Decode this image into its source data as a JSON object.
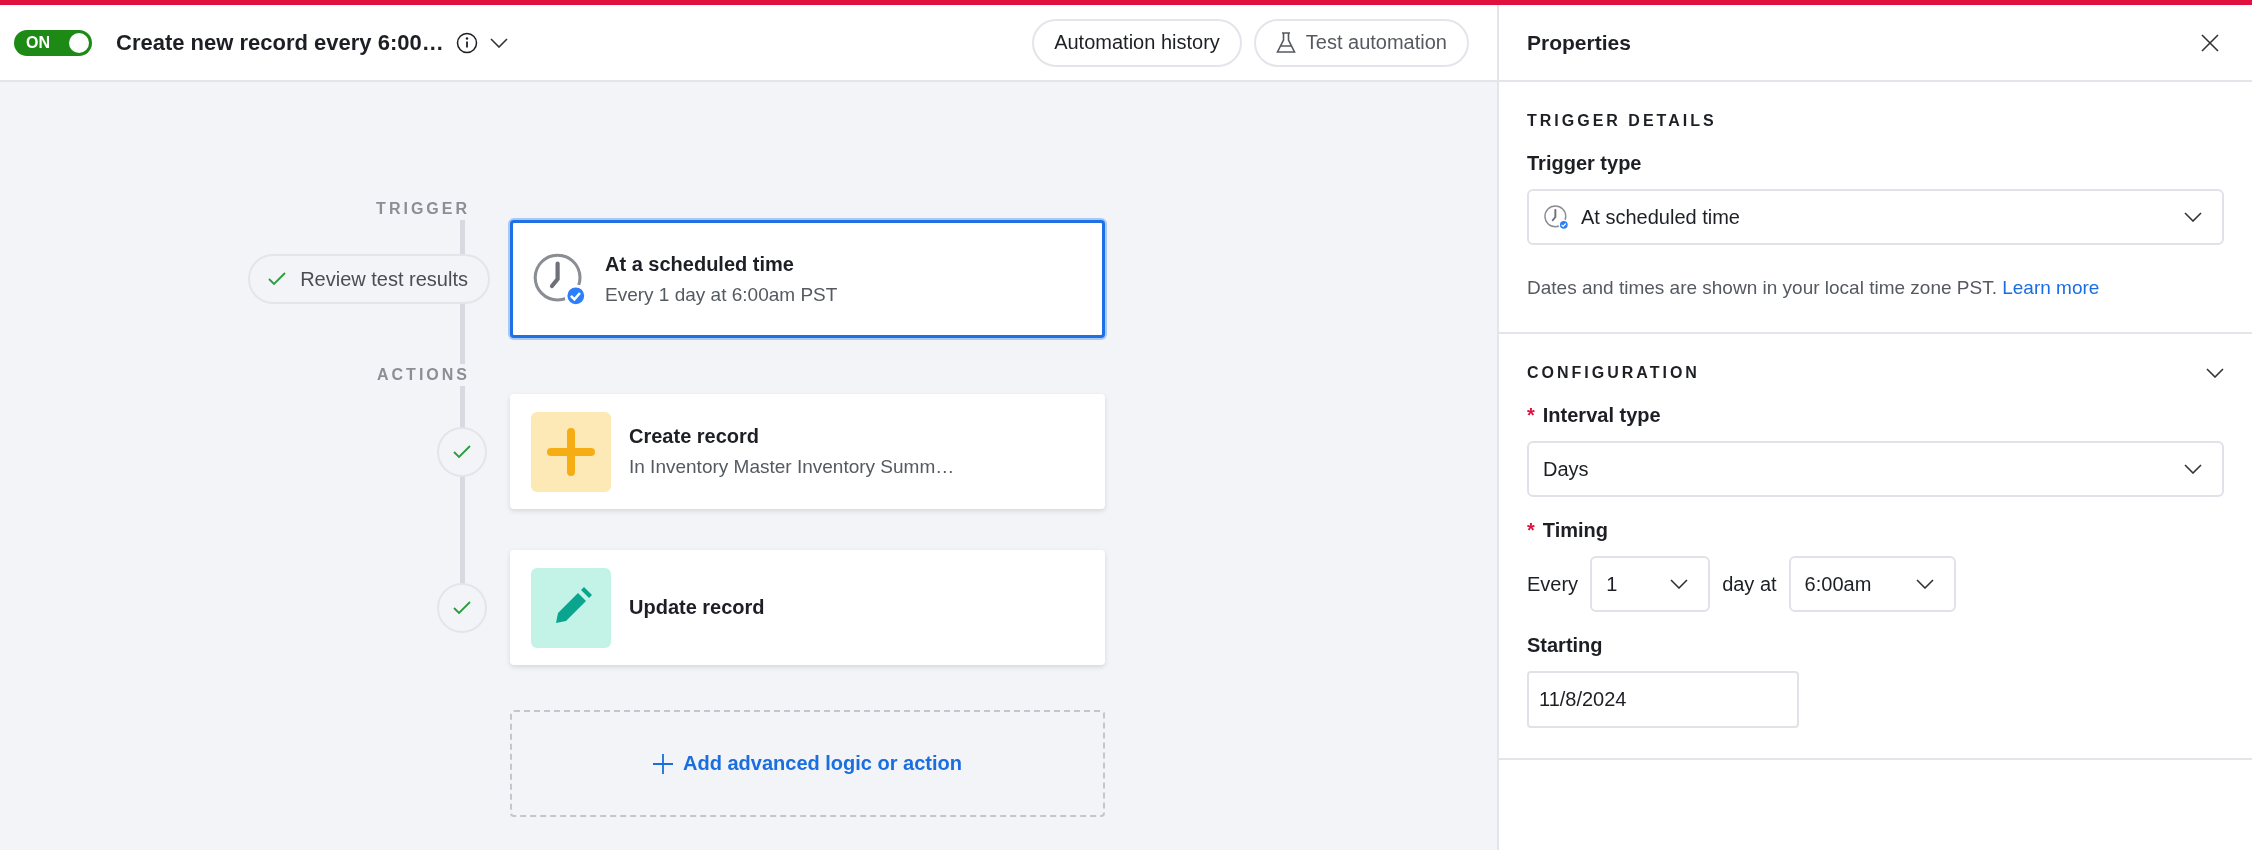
{
  "header": {
    "toggle": {
      "label": "ON",
      "on": true
    },
    "title": "Create new record every 6:00…",
    "buttons": [
      {
        "kind": "plain",
        "label": "Automation history"
      },
      {
        "kind": "flask",
        "label": "Test automation"
      }
    ]
  },
  "flow": {
    "trigger_label": "TRIGGER",
    "test_button": "Review test results",
    "trigger": {
      "title": "At a scheduled time",
      "subtitle": "Every 1 day at 6:00am PST",
      "selected": true
    },
    "actions_label": "ACTIONS",
    "actions": [
      {
        "kind": "create",
        "title": "Create record",
        "subtitle": "In Inventory Master Inventory Summ…",
        "selected": false,
        "done": true
      },
      {
        "kind": "update",
        "title": "Update record",
        "selected": false,
        "done": true
      }
    ],
    "add_button": "Add advanced logic or action"
  },
  "properties": {
    "title": "Properties",
    "trigger_details": {
      "heading": "TRIGGER DETAILS",
      "trigger_type": {
        "label": "Trigger type",
        "value": "At scheduled time"
      },
      "help": "Dates and times are shown in your local time zone PST.",
      "help_link": "Learn more"
    },
    "configuration": {
      "heading": "CONFIGURATION",
      "expanded": true,
      "interval_type": {
        "label": "Interval type",
        "required_mark": "*",
        "value": "Days"
      },
      "timing": {
        "label": "Timing",
        "required_mark": "*",
        "prefix": "Every",
        "count": "1",
        "middle": "day at",
        "time": "6:00am"
      },
      "starting": {
        "label": "Starting",
        "value": "11/8/2024"
      }
    }
  }
}
